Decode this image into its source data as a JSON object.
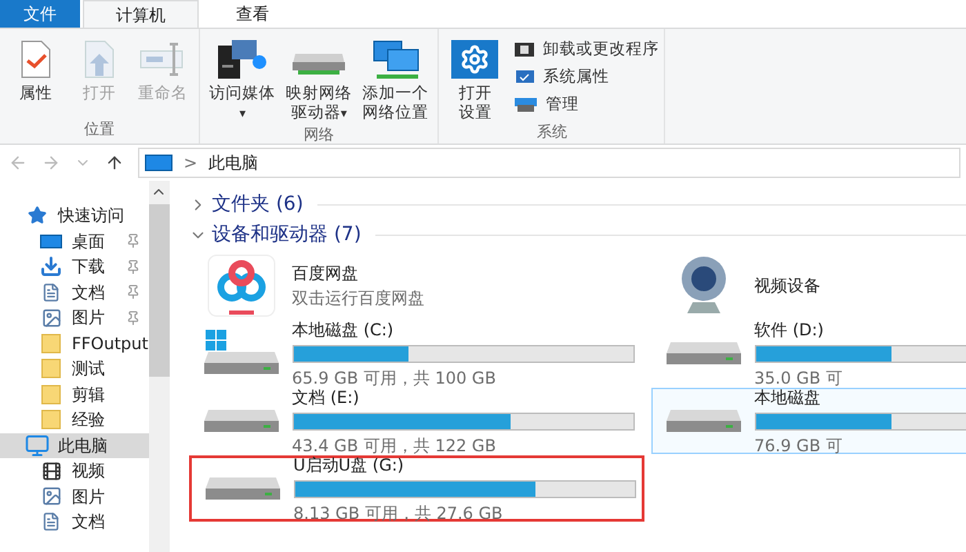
{
  "ribbon_tabs": [
    {
      "label": "文件",
      "kind": "file",
      "selected": false
    },
    {
      "label": "计算机",
      "kind": "tab",
      "selected": true
    },
    {
      "label": "查看",
      "kind": "tab",
      "selected": false
    }
  ],
  "ribbon_groups": [
    {
      "label": "位置",
      "buttons": [
        {
          "label": "属性",
          "disabled": false
        },
        {
          "label": "打开",
          "disabled": true
        },
        {
          "label": "重命名",
          "disabled": true
        }
      ]
    },
    {
      "label": "网络",
      "buttons": [
        {
          "label": "访问媒体",
          "disabled": false,
          "caret": "▾"
        },
        {
          "label": "映射网络驱动器",
          "disabled": false,
          "caret": "▾"
        },
        {
          "label": "添加一个网络位置",
          "disabled": false
        }
      ]
    },
    {
      "label": "系统",
      "buttons": [
        {
          "label": "打开设置",
          "disabled": false
        }
      ],
      "small_items": [
        {
          "label": "卸载或更改程序"
        },
        {
          "label": "系统属性"
        },
        {
          "label": "管理"
        }
      ]
    }
  ],
  "address_bar": {
    "separator": ">",
    "path": "此电脑"
  },
  "sidebar": {
    "items": [
      {
        "label": "快速访问",
        "selected": false,
        "children": [
          {
            "label": "桌面",
            "pinned": true,
            "selected": false
          },
          {
            "label": "下载",
            "pinned": true,
            "selected": false
          },
          {
            "label": "文档",
            "pinned": true,
            "selected": false
          },
          {
            "label": "图片",
            "pinned": true,
            "selected": false
          },
          {
            "label": "FFOutput",
            "pinned": false,
            "selected": false
          },
          {
            "label": "测试",
            "pinned": false,
            "selected": false
          },
          {
            "label": "剪辑",
            "pinned": false,
            "selected": false
          },
          {
            "label": "经验",
            "pinned": false,
            "selected": false
          }
        ]
      },
      {
        "label": "此电脑",
        "selected": true,
        "children": [
          {
            "label": "视频",
            "pinned": false,
            "selected": false
          },
          {
            "label": "图片",
            "pinned": false,
            "selected": false
          },
          {
            "label": "文档",
            "pinned": false,
            "selected": false
          }
        ]
      }
    ]
  },
  "groups": [
    {
      "title": "文件夹 (6)",
      "expanded": false
    },
    {
      "title": "设备和驱动器 (7)",
      "expanded": true
    }
  ],
  "devices": [
    {
      "kind": "app",
      "name": "百度网盘",
      "subtitle": "双击运行百度网盘"
    },
    {
      "kind": "device",
      "name": "视频设备"
    },
    {
      "kind": "drive",
      "name": "本地磁盘 (C:)",
      "level": 0.34,
      "free": "65.9 GB 可用，共 100 GB",
      "system": true,
      "focused": false,
      "annotated": false
    },
    {
      "kind": "drive",
      "name": "软件 (D:)",
      "level": 0.4,
      "free": "35.0 GB 可",
      "system": false,
      "focused": false,
      "annotated": false
    },
    {
      "kind": "drive",
      "name": "文档 (E:)",
      "level": 0.64,
      "free": "43.4 GB 可用，共 122 GB",
      "system": false,
      "focused": false,
      "annotated": false
    },
    {
      "kind": "drive",
      "name": "本地磁盘",
      "level": 0.4,
      "free": "76.9 GB 可",
      "system": false,
      "focused": true,
      "annotated": false
    },
    {
      "kind": "drive",
      "name": "U启动U盘 (G:)",
      "level": 0.71,
      "free": "8.13 GB 可用，共 27.6 GB",
      "system": false,
      "focused": false,
      "annotated": true
    }
  ]
}
